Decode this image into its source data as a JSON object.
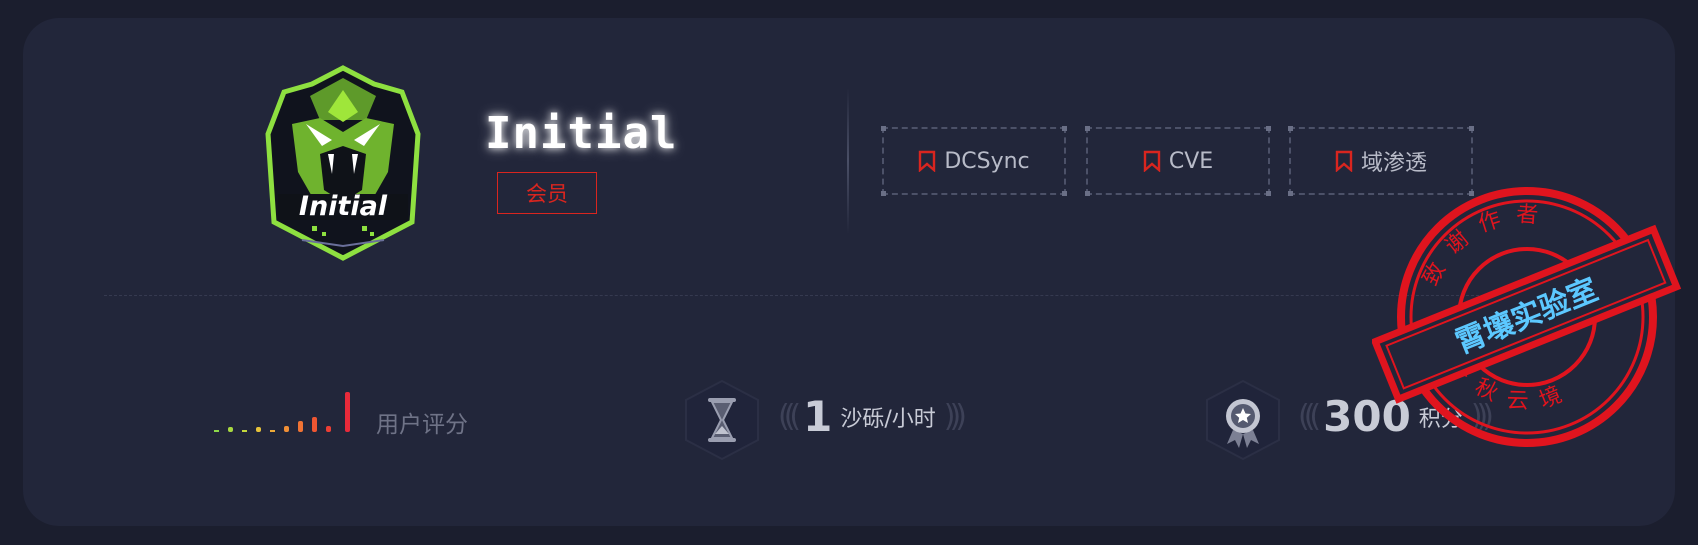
{
  "profile": {
    "name": "Initial",
    "badge": "会员",
    "logo_text": "Initial"
  },
  "tags": [
    {
      "label": "DCSync",
      "icon": "bookmark-icon"
    },
    {
      "label": "CVE",
      "icon": "bookmark-icon"
    },
    {
      "label": "域渗透",
      "icon": "bookmark-icon"
    }
  ],
  "stats": {
    "rating_label": "用户评分",
    "rating_level": 10,
    "rate_value": "1",
    "rate_unit": "沙砾/小时",
    "points_value": "300",
    "points_unit": "积分"
  },
  "stamp": {
    "top_text": "致谢作者",
    "bottom_text": "春秋云境",
    "banner": "霄壤实验室"
  },
  "colors": {
    "accent_red": "#d9251f",
    "logo_green": "#8ee040",
    "stamp_red": "#e0141e",
    "stamp_banner_text": "#5cc8ff"
  }
}
